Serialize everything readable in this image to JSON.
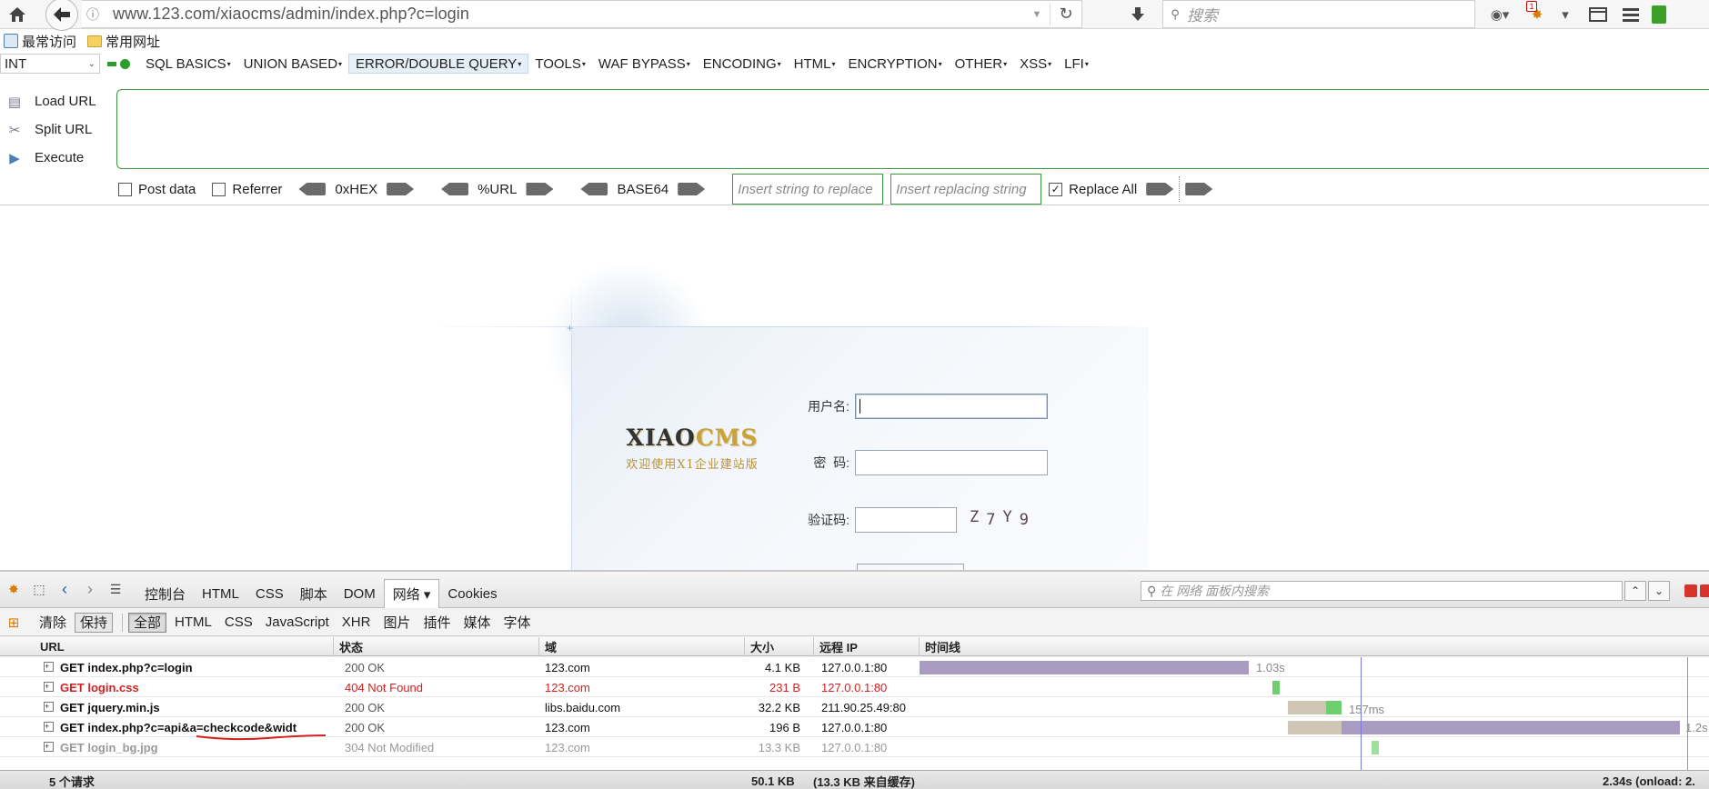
{
  "browser": {
    "url": "www.123.com/xiaocms/admin/index.php?c=login",
    "search_placeholder": "搜索",
    "notification_count": "1"
  },
  "bookmarks": [
    {
      "label": "最常访问",
      "icon": "most-visited-icon"
    },
    {
      "label": "常用网址",
      "icon": "folder-icon"
    }
  ],
  "hackbar": {
    "select_value": "INT",
    "menus": [
      {
        "label": "SQL BASICS"
      },
      {
        "label": "UNION BASED"
      },
      {
        "label": "ERROR/DOUBLE QUERY"
      },
      {
        "label": "TOOLS"
      },
      {
        "label": "WAF BYPASS"
      },
      {
        "label": "ENCODING"
      },
      {
        "label": "HTML"
      },
      {
        "label": "ENCRYPTION"
      },
      {
        "label": "OTHER"
      },
      {
        "label": "XSS"
      },
      {
        "label": "LFI"
      }
    ],
    "actions": [
      {
        "label": "Load URL"
      },
      {
        "label": "Split URL"
      },
      {
        "label": "Execute"
      }
    ],
    "post_data_label": "Post data",
    "referrer_label": "Referrer",
    "hex_label": "0xHEX",
    "url_label": "%URL",
    "base64_label": "BASE64",
    "insert_string_placeholder": "Insert string to replace",
    "insert_replacing_placeholder": "Insert replacing string",
    "replace_all_label": "Replace All",
    "replace_all_checked": true
  },
  "login": {
    "logo_title": "XIAOCMS",
    "logo_title_part1": "XIAO",
    "logo_title_part2": "CMS",
    "logo_subtitle": "欢迎使用X1企业建站版",
    "username_label": "用户名:",
    "password_label": "密  码:",
    "captcha_label": "验证码:",
    "captcha_chars": [
      "Z",
      "7",
      "Y",
      "9"
    ]
  },
  "devtools": {
    "tabs": [
      {
        "label": "控制台"
      },
      {
        "label": "HTML"
      },
      {
        "label": "CSS"
      },
      {
        "label": "脚本"
      },
      {
        "label": "DOM"
      },
      {
        "label": "网络 ▾",
        "active": true
      },
      {
        "label": "Cookies"
      }
    ],
    "search_placeholder": "在 网络 面板内搜索",
    "clear_label": "清除",
    "persist_label": "保持",
    "filters": [
      {
        "label": "全部",
        "active": true
      },
      {
        "label": "HTML"
      },
      {
        "label": "CSS"
      },
      {
        "label": "JavaScript"
      },
      {
        "label": "XHR"
      },
      {
        "label": "图片"
      },
      {
        "label": "插件"
      },
      {
        "label": "媒体"
      },
      {
        "label": "字体"
      }
    ],
    "columns": {
      "url": "URL",
      "status": "状态",
      "domain": "域",
      "size": "大小",
      "ip": "远程 IP",
      "timeline": "时间线"
    },
    "requests": [
      {
        "url": "GET index.php?c=login",
        "status": "200 OK",
        "domain": "123.com",
        "size": "4.1 KB",
        "ip": "127.0.0.1:80",
        "state": "ok",
        "timing": "1.03s"
      },
      {
        "url": "GET login.css",
        "status": "404 Not Found",
        "domain": "123.com",
        "size": "231 B",
        "ip": "127.0.0.1:80",
        "state": "err",
        "timing": ""
      },
      {
        "url": "GET jquery.min.js",
        "status": "200 OK",
        "domain": "libs.baidu.com",
        "size": "32.2 KB",
        "ip": "211.90.25.49:80",
        "state": "ok",
        "timing": "157ms"
      },
      {
        "url": "GET index.php?c=api&a=checkcode&widt",
        "status": "200 OK",
        "domain": "123.com",
        "size": "196 B",
        "ip": "127.0.0.1:80",
        "state": "ok",
        "timing": "1.2s"
      },
      {
        "url": "GET login_bg.jpg",
        "status": "304 Not Modified",
        "domain": "123.com",
        "size": "13.3 KB",
        "ip": "127.0.0.1:80",
        "state": "cached",
        "timing": ""
      }
    ],
    "footer": {
      "count": "5 个请求",
      "total_size": "50.1 KB",
      "cached": "(13.3 KB 来自缓存)",
      "total_time": "2.34s (onload: 2."
    },
    "colors": {
      "bar_purple": "#a99bc2",
      "bar_tan": "#cfc6b5",
      "bar_green": "#6fcf6f",
      "error_red": "#d42020"
    }
  }
}
